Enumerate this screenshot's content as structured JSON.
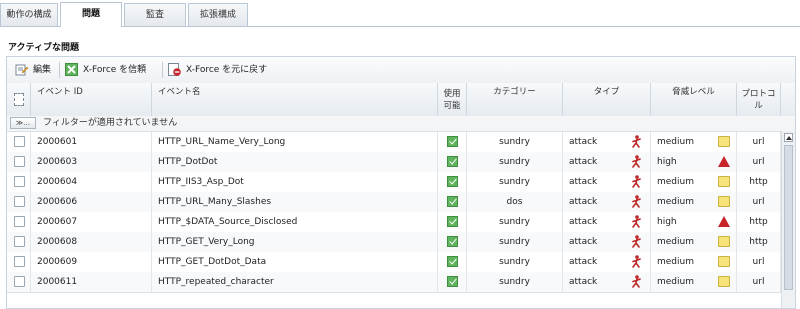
{
  "tabs": [
    {
      "label": "動作の構成",
      "active": false
    },
    {
      "label": "問題",
      "active": true
    },
    {
      "label": "監査",
      "active": false
    },
    {
      "label": "拡張構成",
      "active": false
    }
  ],
  "section_title": "アクティブな問題",
  "toolbar": {
    "edit_label": "編集",
    "trust_label": "X-Force を信頼",
    "revert_label": "X-Force を元に戻す"
  },
  "columns": {
    "event_id": "イベント ID",
    "event_name": "イベント名",
    "enabled": "使用可能",
    "category": "カテゴリー",
    "type": "タイプ",
    "severity": "脅威レベル",
    "protocol": "プロトコル"
  },
  "filter": {
    "button_label": "≫…",
    "status_text": "フィルターが適用されていません"
  },
  "rows": [
    {
      "id": "2000601",
      "name": "HTTP_URL_Name_Very_Long",
      "enabled": true,
      "category": "sundry",
      "type": "attack",
      "severity": "medium",
      "protocol": "url"
    },
    {
      "id": "2000603",
      "name": "HTTP_DotDot",
      "enabled": true,
      "category": "sundry",
      "type": "attack",
      "severity": "high",
      "protocol": "url"
    },
    {
      "id": "2000604",
      "name": "HTTP_IIS3_Asp_Dot",
      "enabled": true,
      "category": "sundry",
      "type": "attack",
      "severity": "medium",
      "protocol": "http"
    },
    {
      "id": "2000606",
      "name": "HTTP_URL_Many_Slashes",
      "enabled": true,
      "category": "dos",
      "type": "attack",
      "severity": "medium",
      "protocol": "url"
    },
    {
      "id": "2000607",
      "name": "HTTP_$DATA_Source_Disclosed",
      "enabled": true,
      "category": "sundry",
      "type": "attack",
      "severity": "high",
      "protocol": "http"
    },
    {
      "id": "2000608",
      "name": "HTTP_GET_Very_Long",
      "enabled": true,
      "category": "sundry",
      "type": "attack",
      "severity": "medium",
      "protocol": "http"
    },
    {
      "id": "2000609",
      "name": "HTTP_GET_DotDot_Data",
      "enabled": true,
      "category": "sundry",
      "type": "attack",
      "severity": "medium",
      "protocol": "url"
    },
    {
      "id": "2000611",
      "name": "HTTP_repeated_character",
      "enabled": true,
      "category": "sundry",
      "type": "attack",
      "severity": "medium",
      "protocol": "url"
    }
  ],
  "colors": {
    "enabled_green": "#5fb35c",
    "medium_yellow": "#f6e37a",
    "high_red": "#c8242a",
    "attack_red": "#c0282a"
  }
}
